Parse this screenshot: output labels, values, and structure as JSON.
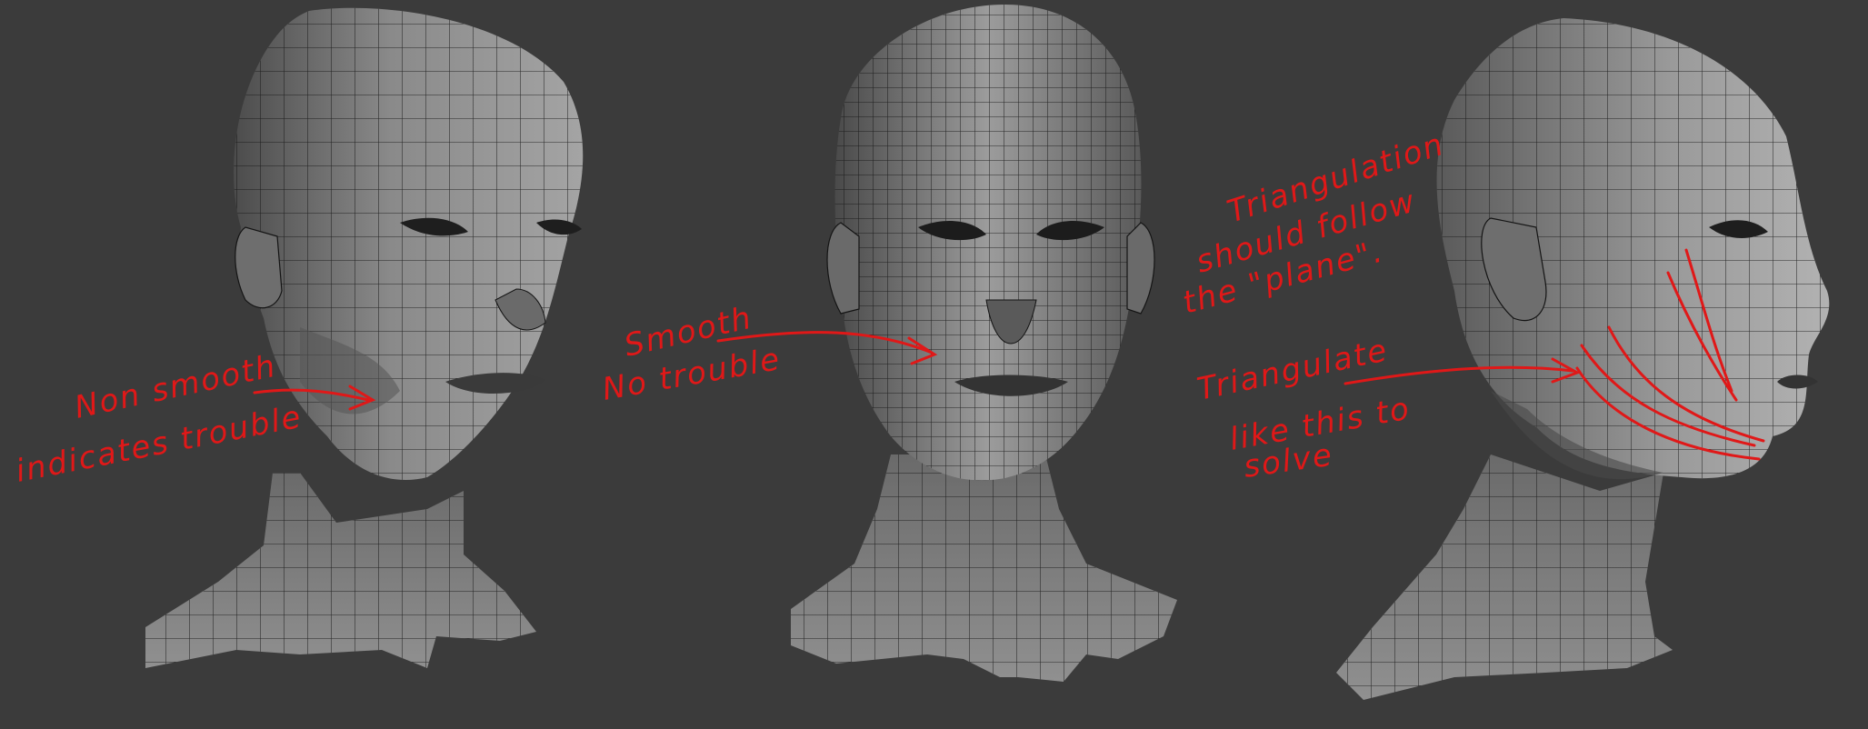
{
  "annotations": {
    "non_smooth_1": "Non smooth",
    "non_smooth_2": "indicates trouble",
    "smooth_1": "Smooth",
    "smooth_2": "No trouble",
    "tri_plane_1": "Triangulation",
    "tri_plane_2": "should follow",
    "tri_plane_3": "the \"plane\".",
    "tri_solve_1": "Triangulate",
    "tri_solve_2": "like this to",
    "tri_solve_3": "solve"
  },
  "colors": {
    "background": "#3b3b3b",
    "mesh_light": "#a8a8a8",
    "mesh_mid": "#7c7c7c",
    "mesh_dark": "#4a4a4a",
    "wire": "#141414",
    "annotation": "#e01818"
  }
}
